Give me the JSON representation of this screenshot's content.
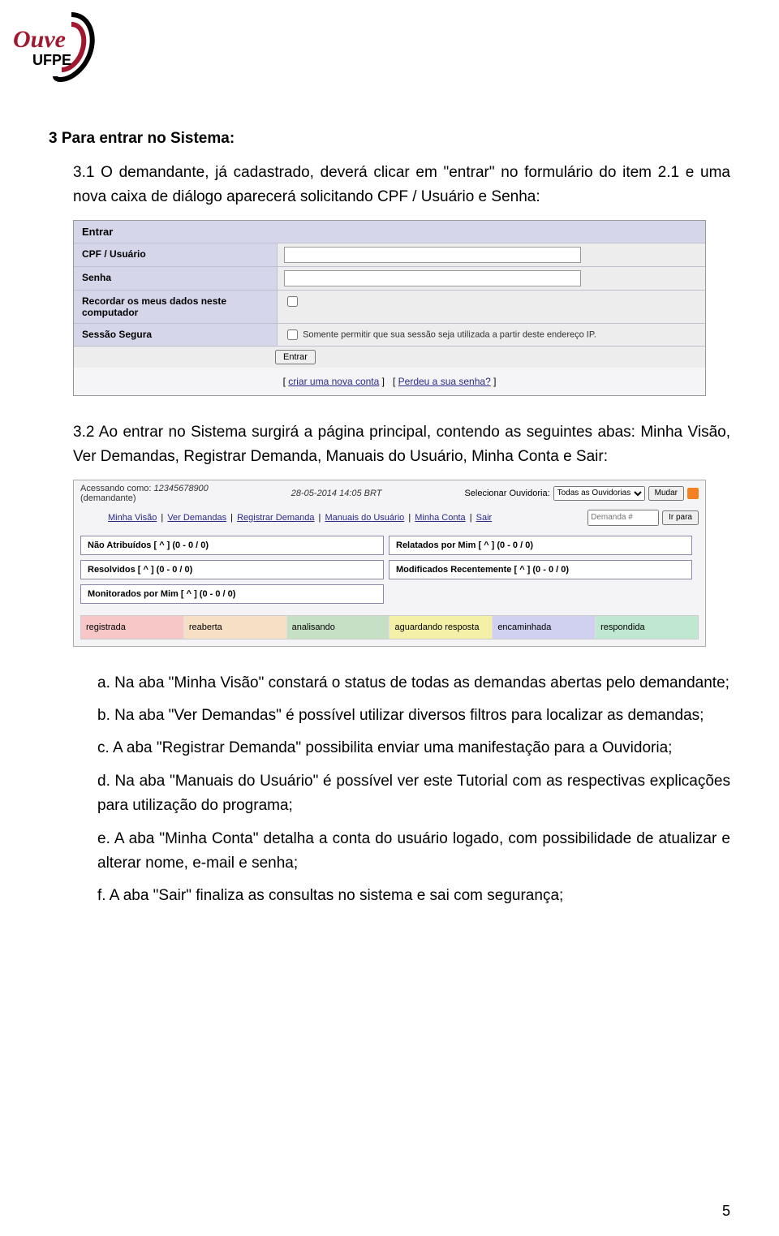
{
  "logo": {
    "brand": "Ouve",
    "sub": "UFPE"
  },
  "section_title": "3  Para entrar no Sistema:",
  "p31": "3.1 O demandante, já cadastrado, deverá clicar em \"entrar\" no formulário do item 2.1 e uma nova caixa de diálogo aparecerá solicitando CPF / Usuário e Senha:",
  "login": {
    "header": "Entrar",
    "row_cpf": "CPF / Usuário",
    "row_senha": "Senha",
    "row_recordar": "Recordar os meus dados neste computador",
    "row_sessao": "Sessão Segura",
    "sessao_hint": "Somente permitir que sua sessão seja utilizada a partir deste endereço IP.",
    "submit": "Entrar",
    "link_criar": "criar uma nova conta",
    "link_perdeu": "Perdeu a sua senha?"
  },
  "p32": "3.2 Ao entrar no Sistema surgirá a página principal, contendo as seguintes abas: Minha Visão, Ver Demandas, Registrar Demanda, Manuais do Usuário, Minha Conta e Sair:",
  "dash": {
    "access_label": "Acessando como:",
    "access_user": "12345678900",
    "access_role": "(demandante)",
    "timestamp": "28-05-2014 14:05 BRT",
    "ouvidoria_label": "Selecionar Ouvidoria:",
    "ouvidoria_value": "Todas as Ouvidorias",
    "mudar": "Mudar",
    "menu": [
      "Minha Visão",
      "Ver Demandas",
      "Registrar Demanda",
      "Manuais do Usuário",
      "Minha Conta",
      "Sair"
    ],
    "demanda_ph": "Demanda #",
    "irpara": "Ir para",
    "panels": [
      "Não Atribuídos [ ^ ] (0 - 0 / 0)",
      "Relatados por Mim [ ^ ] (0 - 0 / 0)",
      "Resolvidos [ ^ ] (0 - 0 / 0)",
      "Modificados Recentemente [ ^ ] (0 - 0 / 0)",
      "Monitorados por Mim [ ^ ] (0 - 0 / 0)"
    ],
    "statuses": [
      "registrada",
      "reaberta",
      "analisando",
      "aguardando resposta",
      "encaminhada",
      "respondida"
    ]
  },
  "items": {
    "a": "a. Na aba \"Minha Visão\" constará o status de todas as demandas abertas pelo demandante;",
    "b": "b. Na aba \"Ver Demandas\" é possível utilizar diversos filtros para localizar as demandas;",
    "c": "c. A aba \"Registrar Demanda\" possibilita enviar uma manifestação para a Ouvidoria;",
    "d": "d. Na aba \"Manuais do Usuário\" é possível ver este Tutorial com as respectivas explicações para utilização do programa;",
    "e": "e. A aba \"Minha Conta\" detalha a conta do usuário logado, com possibilidade de atualizar e alterar nome, e-mail e senha;",
    "f": "f. A aba \"Sair\" finaliza as consultas no sistema e sai com segurança;"
  },
  "page_number": "5"
}
